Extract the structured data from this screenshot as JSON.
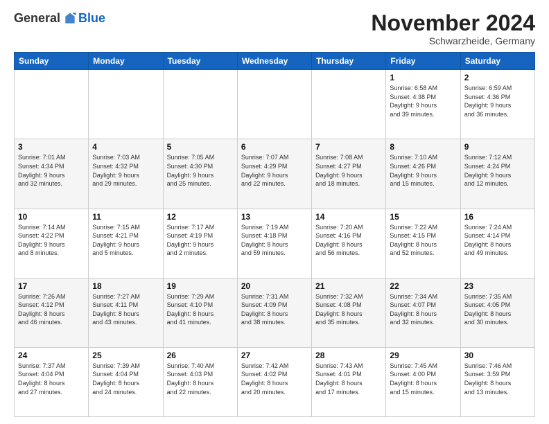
{
  "header": {
    "logo": {
      "general": "General",
      "blue": "Blue"
    },
    "title": "November 2024",
    "subtitle": "Schwarzheide, Germany"
  },
  "days_of_week": [
    "Sunday",
    "Monday",
    "Tuesday",
    "Wednesday",
    "Thursday",
    "Friday",
    "Saturday"
  ],
  "weeks": [
    [
      {
        "day": "",
        "info": ""
      },
      {
        "day": "",
        "info": ""
      },
      {
        "day": "",
        "info": ""
      },
      {
        "day": "",
        "info": ""
      },
      {
        "day": "",
        "info": ""
      },
      {
        "day": "1",
        "info": "Sunrise: 6:58 AM\nSunset: 4:38 PM\nDaylight: 9 hours\nand 39 minutes."
      },
      {
        "day": "2",
        "info": "Sunrise: 6:59 AM\nSunset: 4:36 PM\nDaylight: 9 hours\nand 36 minutes."
      }
    ],
    [
      {
        "day": "3",
        "info": "Sunrise: 7:01 AM\nSunset: 4:34 PM\nDaylight: 9 hours\nand 32 minutes."
      },
      {
        "day": "4",
        "info": "Sunrise: 7:03 AM\nSunset: 4:32 PM\nDaylight: 9 hours\nand 29 minutes."
      },
      {
        "day": "5",
        "info": "Sunrise: 7:05 AM\nSunset: 4:30 PM\nDaylight: 9 hours\nand 25 minutes."
      },
      {
        "day": "6",
        "info": "Sunrise: 7:07 AM\nSunset: 4:29 PM\nDaylight: 9 hours\nand 22 minutes."
      },
      {
        "day": "7",
        "info": "Sunrise: 7:08 AM\nSunset: 4:27 PM\nDaylight: 9 hours\nand 18 minutes."
      },
      {
        "day": "8",
        "info": "Sunrise: 7:10 AM\nSunset: 4:26 PM\nDaylight: 9 hours\nand 15 minutes."
      },
      {
        "day": "9",
        "info": "Sunrise: 7:12 AM\nSunset: 4:24 PM\nDaylight: 9 hours\nand 12 minutes."
      }
    ],
    [
      {
        "day": "10",
        "info": "Sunrise: 7:14 AM\nSunset: 4:22 PM\nDaylight: 9 hours\nand 8 minutes."
      },
      {
        "day": "11",
        "info": "Sunrise: 7:15 AM\nSunset: 4:21 PM\nDaylight: 9 hours\nand 5 minutes."
      },
      {
        "day": "12",
        "info": "Sunrise: 7:17 AM\nSunset: 4:19 PM\nDaylight: 9 hours\nand 2 minutes."
      },
      {
        "day": "13",
        "info": "Sunrise: 7:19 AM\nSunset: 4:18 PM\nDaylight: 8 hours\nand 59 minutes."
      },
      {
        "day": "14",
        "info": "Sunrise: 7:20 AM\nSunset: 4:16 PM\nDaylight: 8 hours\nand 56 minutes."
      },
      {
        "day": "15",
        "info": "Sunrise: 7:22 AM\nSunset: 4:15 PM\nDaylight: 8 hours\nand 52 minutes."
      },
      {
        "day": "16",
        "info": "Sunrise: 7:24 AM\nSunset: 4:14 PM\nDaylight: 8 hours\nand 49 minutes."
      }
    ],
    [
      {
        "day": "17",
        "info": "Sunrise: 7:26 AM\nSunset: 4:12 PM\nDaylight: 8 hours\nand 46 minutes."
      },
      {
        "day": "18",
        "info": "Sunrise: 7:27 AM\nSunset: 4:11 PM\nDaylight: 8 hours\nand 43 minutes."
      },
      {
        "day": "19",
        "info": "Sunrise: 7:29 AM\nSunset: 4:10 PM\nDaylight: 8 hours\nand 41 minutes."
      },
      {
        "day": "20",
        "info": "Sunrise: 7:31 AM\nSunset: 4:09 PM\nDaylight: 8 hours\nand 38 minutes."
      },
      {
        "day": "21",
        "info": "Sunrise: 7:32 AM\nSunset: 4:08 PM\nDaylight: 8 hours\nand 35 minutes."
      },
      {
        "day": "22",
        "info": "Sunrise: 7:34 AM\nSunset: 4:07 PM\nDaylight: 8 hours\nand 32 minutes."
      },
      {
        "day": "23",
        "info": "Sunrise: 7:35 AM\nSunset: 4:05 PM\nDaylight: 8 hours\nand 30 minutes."
      }
    ],
    [
      {
        "day": "24",
        "info": "Sunrise: 7:37 AM\nSunset: 4:04 PM\nDaylight: 8 hours\nand 27 minutes."
      },
      {
        "day": "25",
        "info": "Sunrise: 7:39 AM\nSunset: 4:04 PM\nDaylight: 8 hours\nand 24 minutes."
      },
      {
        "day": "26",
        "info": "Sunrise: 7:40 AM\nSunset: 4:03 PM\nDaylight: 8 hours\nand 22 minutes."
      },
      {
        "day": "27",
        "info": "Sunrise: 7:42 AM\nSunset: 4:02 PM\nDaylight: 8 hours\nand 20 minutes."
      },
      {
        "day": "28",
        "info": "Sunrise: 7:43 AM\nSunset: 4:01 PM\nDaylight: 8 hours\nand 17 minutes."
      },
      {
        "day": "29",
        "info": "Sunrise: 7:45 AM\nSunset: 4:00 PM\nDaylight: 8 hours\nand 15 minutes."
      },
      {
        "day": "30",
        "info": "Sunrise: 7:46 AM\nSunset: 3:59 PM\nDaylight: 8 hours\nand 13 minutes."
      }
    ]
  ]
}
